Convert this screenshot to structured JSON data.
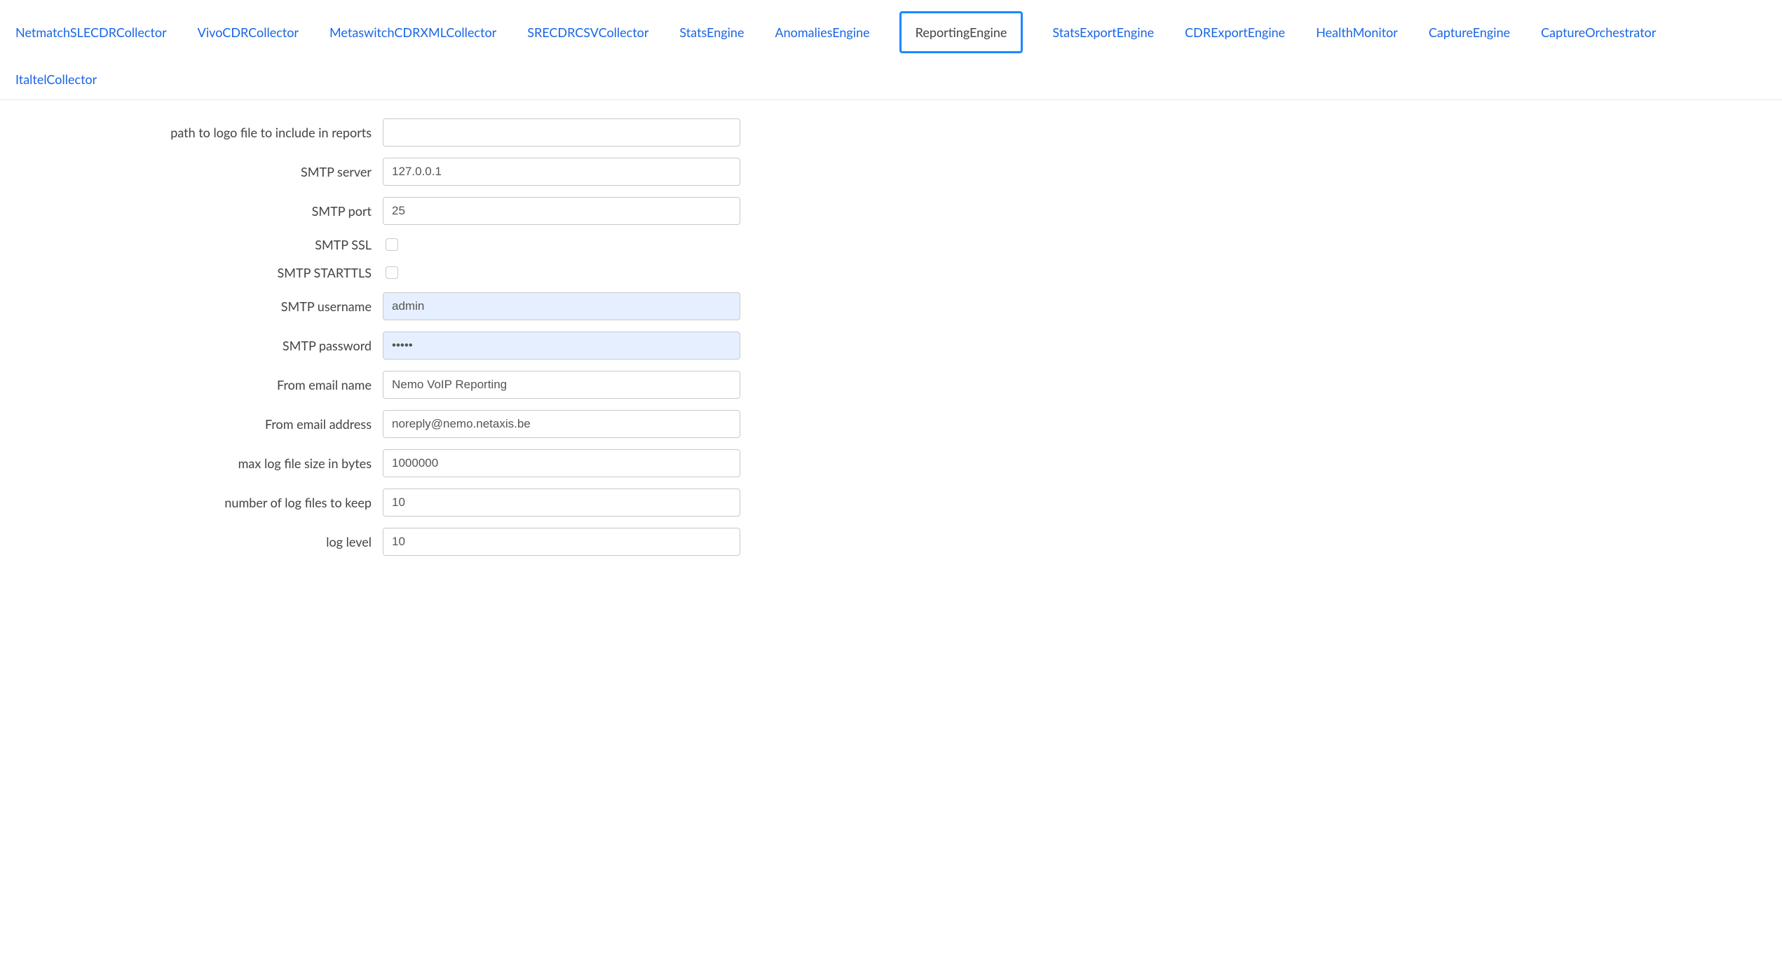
{
  "tabs": {
    "items": [
      {
        "label": "NetmatchSLECDRCollector",
        "active": false
      },
      {
        "label": "VivoCDRCollector",
        "active": false
      },
      {
        "label": "MetaswitchCDRXMLCollector",
        "active": false
      },
      {
        "label": "SRECDRCSVCollector",
        "active": false
      },
      {
        "label": "StatsEngine",
        "active": false
      },
      {
        "label": "AnomaliesEngine",
        "active": false
      },
      {
        "label": "ReportingEngine",
        "active": true
      },
      {
        "label": "StatsExportEngine",
        "active": false
      },
      {
        "label": "CDRExportEngine",
        "active": false
      },
      {
        "label": "HealthMonitor",
        "active": false
      },
      {
        "label": "CaptureEngine",
        "active": false
      },
      {
        "label": "CaptureOrchestrator",
        "active": false
      },
      {
        "label": "ItaltelCollector",
        "active": false
      }
    ]
  },
  "form": {
    "logo_path": {
      "label": "path to logo file to include in reports",
      "value": ""
    },
    "smtp_server": {
      "label": "SMTP server",
      "value": "127.0.0.1"
    },
    "smtp_port": {
      "label": "SMTP port",
      "value": "25"
    },
    "smtp_ssl": {
      "label": "SMTP SSL",
      "checked": false
    },
    "smtp_starttls": {
      "label": "SMTP STARTTLS",
      "checked": false
    },
    "smtp_user": {
      "label": "SMTP username",
      "value": "admin"
    },
    "smtp_pass": {
      "label": "SMTP password",
      "value": "•••••"
    },
    "from_name": {
      "label": "From email name",
      "value": "Nemo VoIP Reporting"
    },
    "from_addr": {
      "label": "From email address",
      "value": "noreply@nemo.netaxis.be"
    },
    "max_log_size": {
      "label": "max log file size in bytes",
      "value": "1000000"
    },
    "log_keep": {
      "label": "number of log files to keep",
      "value": "10"
    },
    "log_level": {
      "label": "log level",
      "value": "10"
    }
  }
}
